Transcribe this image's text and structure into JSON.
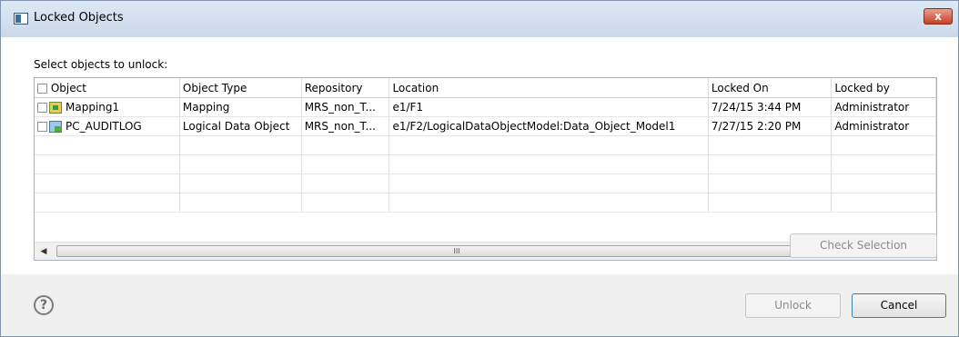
{
  "window": {
    "title": "Locked Objects",
    "close_label": "x"
  },
  "instruction": "Select objects to unlock:",
  "table": {
    "columns": [
      "Object",
      "Object Type",
      "Repository",
      "Location",
      "Locked On",
      "Locked by"
    ],
    "rows": [
      {
        "object": "Mapping1",
        "icon": "mapping-icon",
        "object_type": "Mapping",
        "repository": "MRS_non_T...",
        "location": "e1/F1",
        "locked_on": "7/24/15 3:44 PM",
        "locked_by": "Administrator"
      },
      {
        "object": "PC_AUDITLOG",
        "icon": "logical-data-object-icon",
        "object_type": "Logical Data Object",
        "repository": "MRS_non_T...",
        "location": "e1/F2/LogicalDataObjectModel:Data_Object_Model1",
        "locked_on": "7/27/15 2:20 PM",
        "locked_by": "Administrator"
      }
    ]
  },
  "scrollbar": {
    "left_arrow": "◀",
    "right_arrow": "▶",
    "thumb_grip": "III"
  },
  "buttons": {
    "check_selection": "Check Selection",
    "unlock": "Unlock",
    "cancel": "Cancel"
  },
  "help": {
    "icon": "help-icon",
    "glyph": "?"
  },
  "colors": {
    "title_bar": "#c9d8ea",
    "close_button": "#c7402b",
    "focus_border": "#3c7fb1"
  }
}
